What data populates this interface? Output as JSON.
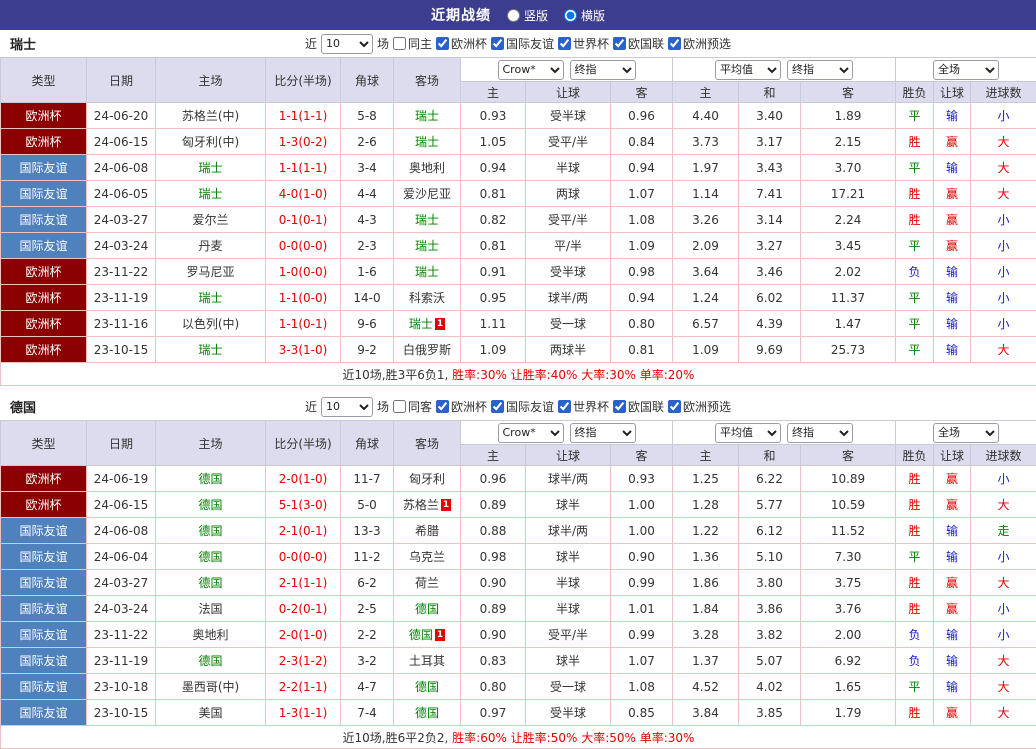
{
  "topbar": {
    "title": "近期战绩",
    "layout_options": [
      {
        "label": "竖版",
        "selected": false
      },
      {
        "label": "横版",
        "selected": true
      }
    ]
  },
  "filters": {
    "near_label": "近",
    "count_value": "10",
    "unit_label": "场",
    "competitions": [
      "欧洲杯",
      "国际友谊",
      "世界杯",
      "欧国联",
      "欧洲预选"
    ]
  },
  "table_headers": {
    "type": "类型",
    "date": "日期",
    "home": "主场",
    "score": "比分(半场)",
    "corner": "角球",
    "away": "客场",
    "bookmaker_select": "Crow*",
    "final_select": "终指",
    "average_select": "平均值",
    "final_select2": "终指",
    "period_select": "全场",
    "sub": [
      "主",
      "让球",
      "客",
      "主",
      "和",
      "客",
      "胜负",
      "让球",
      "进球数"
    ]
  },
  "colors": {
    "type_bg": {
      "欧洲杯": "#8b0000",
      "国际友谊": "#4f81bd"
    },
    "subject_team": "#008000",
    "score": "#e60000",
    "result": {
      "胜": "#e60000",
      "平": "#008000",
      "负": "#1a1ace"
    },
    "handicap": {
      "赢": "#e60000",
      "输": "#1a1ace",
      "走": "#008000"
    },
    "goals": {
      "大": "#e60000",
      "小": "#1a1ace",
      "走": "#008000"
    }
  },
  "sections": [
    {
      "team": "瑞士",
      "same_filter_label": "同主",
      "rows": [
        {
          "type": "欧洲杯",
          "date": "24-06-20",
          "home": "苏格兰(中)",
          "home_subject": false,
          "score": "1-1(1-1)",
          "corner": "5-8",
          "away": "瑞士",
          "away_subject": true,
          "odds": [
            "0.93",
            "受半球",
            "0.96",
            "4.40",
            "3.40",
            "1.89"
          ],
          "result": "平",
          "handicap": "输",
          "goals": "小"
        },
        {
          "type": "欧洲杯",
          "date": "24-06-15",
          "home": "匈牙利(中)",
          "home_subject": false,
          "score": "1-3(0-2)",
          "corner": "2-6",
          "away": "瑞士",
          "away_subject": true,
          "odds": [
            "1.05",
            "受平/半",
            "0.84",
            "3.73",
            "3.17",
            "2.15"
          ],
          "result": "胜",
          "handicap": "赢",
          "goals": "大"
        },
        {
          "type": "国际友谊",
          "date": "24-06-08",
          "home": "瑞士",
          "home_subject": true,
          "score": "1-1(1-1)",
          "corner": "3-4",
          "away": "奥地利",
          "away_subject": false,
          "odds": [
            "0.94",
            "半球",
            "0.94",
            "1.97",
            "3.43",
            "3.70"
          ],
          "result": "平",
          "handicap": "输",
          "goals": "大"
        },
        {
          "type": "国际友谊",
          "date": "24-06-05",
          "home": "瑞士",
          "home_subject": true,
          "score": "4-0(1-0)",
          "corner": "4-4",
          "away": "爱沙尼亚",
          "away_subject": false,
          "odds": [
            "0.81",
            "两球",
            "1.07",
            "1.14",
            "7.41",
            "17.21"
          ],
          "result": "胜",
          "handicap": "赢",
          "goals": "大"
        },
        {
          "type": "国际友谊",
          "date": "24-03-27",
          "home": "爱尔兰",
          "home_subject": false,
          "score": "0-1(0-1)",
          "corner": "4-3",
          "away": "瑞士",
          "away_subject": true,
          "odds": [
            "0.82",
            "受平/半",
            "1.08",
            "3.26",
            "3.14",
            "2.24"
          ],
          "result": "胜",
          "handicap": "赢",
          "goals": "小"
        },
        {
          "type": "国际友谊",
          "date": "24-03-24",
          "home": "丹麦",
          "home_subject": false,
          "score": "0-0(0-0)",
          "corner": "2-3",
          "away": "瑞士",
          "away_subject": true,
          "odds": [
            "0.81",
            "平/半",
            "1.09",
            "2.09",
            "3.27",
            "3.45"
          ],
          "result": "平",
          "handicap": "赢",
          "goals": "小"
        },
        {
          "type": "欧洲杯",
          "date": "23-11-22",
          "home": "罗马尼亚",
          "home_subject": false,
          "score": "1-0(0-0)",
          "corner": "1-6",
          "away": "瑞士",
          "away_subject": true,
          "odds": [
            "0.91",
            "受半球",
            "0.98",
            "3.64",
            "3.46",
            "2.02"
          ],
          "result": "负",
          "handicap": "输",
          "goals": "小"
        },
        {
          "type": "欧洲杯",
          "date": "23-11-19",
          "home": "瑞士",
          "home_subject": true,
          "score": "1-1(0-0)",
          "corner": "14-0",
          "away": "科索沃",
          "away_subject": false,
          "odds": [
            "0.95",
            "球半/两",
            "0.94",
            "1.24",
            "6.02",
            "11.37"
          ],
          "result": "平",
          "handicap": "输",
          "goals": "小"
        },
        {
          "type": "欧洲杯",
          "date": "23-11-16",
          "home": "以色列(中)",
          "home_subject": false,
          "score": "1-1(0-1)",
          "corner": "9-6",
          "away": "瑞士",
          "away_subject": true,
          "away_card": "1",
          "odds": [
            "1.11",
            "受一球",
            "0.80",
            "6.57",
            "4.39",
            "1.47"
          ],
          "result": "平",
          "handicap": "输",
          "goals": "小"
        },
        {
          "type": "欧洲杯",
          "date": "23-10-15",
          "home": "瑞士",
          "home_subject": true,
          "score": "3-3(1-0)",
          "corner": "9-2",
          "away": "白俄罗斯",
          "away_subject": false,
          "odds": [
            "1.09",
            "两球半",
            "0.81",
            "1.09",
            "9.69",
            "25.73"
          ],
          "result": "平",
          "handicap": "输",
          "goals": "大"
        }
      ],
      "summary_prefix": "近10场,胜3平6负1, ",
      "summary_rates": "胜率:30% 让胜率:40% 大率:30% 单率:20%"
    },
    {
      "team": "德国",
      "same_filter_label": "同客",
      "rows": [
        {
          "type": "欧洲杯",
          "date": "24-06-19",
          "home": "德国",
          "home_subject": true,
          "score": "2-0(1-0)",
          "corner": "11-7",
          "away": "匈牙利",
          "away_subject": false,
          "odds": [
            "0.96",
            "球半/两",
            "0.93",
            "1.25",
            "6.22",
            "10.89"
          ],
          "result": "胜",
          "handicap": "赢",
          "goals": "小"
        },
        {
          "type": "欧洲杯",
          "date": "24-06-15",
          "home": "德国",
          "home_subject": true,
          "score": "5-1(3-0)",
          "corner": "5-0",
          "away": "苏格兰",
          "away_subject": false,
          "away_card": "1",
          "odds": [
            "0.89",
            "球半",
            "1.00",
            "1.28",
            "5.77",
            "10.59"
          ],
          "result": "胜",
          "handicap": "赢",
          "goals": "大"
        },
        {
          "type": "国际友谊",
          "date": "24-06-08",
          "home": "德国",
          "home_subject": true,
          "score": "2-1(0-1)",
          "corner": "13-3",
          "away": "希腊",
          "away_subject": false,
          "odds": [
            "0.88",
            "球半/两",
            "1.00",
            "1.22",
            "6.12",
            "11.52"
          ],
          "result": "胜",
          "handicap": "输",
          "goals": "走"
        },
        {
          "type": "国际友谊",
          "date": "24-06-04",
          "home": "德国",
          "home_subject": true,
          "score": "0-0(0-0)",
          "corner": "11-2",
          "away": "乌克兰",
          "away_subject": false,
          "odds": [
            "0.98",
            "球半",
            "0.90",
            "1.36",
            "5.10",
            "7.30"
          ],
          "result": "平",
          "handicap": "输",
          "goals": "小"
        },
        {
          "type": "国际友谊",
          "date": "24-03-27",
          "home": "德国",
          "home_subject": true,
          "score": "2-1(1-1)",
          "corner": "6-2",
          "away": "荷兰",
          "away_subject": false,
          "odds": [
            "0.90",
            "半球",
            "0.99",
            "1.86",
            "3.80",
            "3.75"
          ],
          "result": "胜",
          "handicap": "赢",
          "goals": "大"
        },
        {
          "type": "国际友谊",
          "date": "24-03-24",
          "home": "法国",
          "home_subject": false,
          "score": "0-2(0-1)",
          "corner": "2-5",
          "away": "德国",
          "away_subject": true,
          "odds": [
            "0.89",
            "半球",
            "1.01",
            "1.84",
            "3.86",
            "3.76"
          ],
          "result": "胜",
          "handicap": "赢",
          "goals": "小"
        },
        {
          "type": "国际友谊",
          "date": "23-11-22",
          "home": "奥地利",
          "home_subject": false,
          "score": "2-0(1-0)",
          "corner": "2-2",
          "away": "德国",
          "away_subject": true,
          "away_card": "1",
          "odds": [
            "0.90",
            "受平/半",
            "0.99",
            "3.28",
            "3.82",
            "2.00"
          ],
          "result": "负",
          "handicap": "输",
          "goals": "小"
        },
        {
          "type": "国际友谊",
          "date": "23-11-19",
          "home": "德国",
          "home_subject": true,
          "score": "2-3(1-2)",
          "corner": "3-2",
          "away": "土耳其",
          "away_subject": false,
          "odds": [
            "0.83",
            "球半",
            "1.07",
            "1.37",
            "5.07",
            "6.92"
          ],
          "result": "负",
          "handicap": "输",
          "goals": "大"
        },
        {
          "type": "国际友谊",
          "date": "23-10-18",
          "home": "墨西哥(中)",
          "home_subject": false,
          "score": "2-2(1-1)",
          "corner": "4-7",
          "away": "德国",
          "away_subject": true,
          "odds": [
            "0.80",
            "受一球",
            "1.08",
            "4.52",
            "4.02",
            "1.65"
          ],
          "result": "平",
          "handicap": "输",
          "goals": "大"
        },
        {
          "type": "国际友谊",
          "date": "23-10-15",
          "home": "美国",
          "home_subject": false,
          "score": "1-3(1-1)",
          "corner": "7-4",
          "away": "德国",
          "away_subject": true,
          "odds": [
            "0.97",
            "受半球",
            "0.85",
            "3.84",
            "3.85",
            "1.79"
          ],
          "result": "胜",
          "handicap": "赢",
          "goals": "大"
        }
      ],
      "summary_prefix": "近10场,胜6平2负2, ",
      "summary_rates": "胜率:60% 让胜率:50% 大率:50% 单率:30%"
    }
  ]
}
